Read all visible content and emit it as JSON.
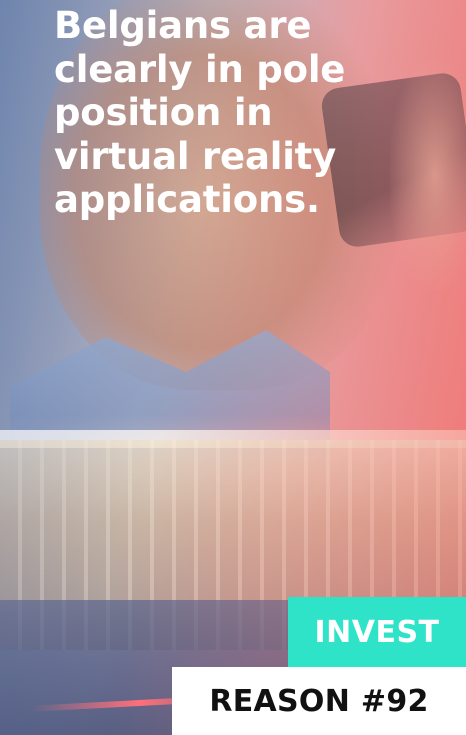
{
  "headline": {
    "lines": [
      "Belgians are",
      "clearly in pole",
      "position in",
      "virtual reality",
      "applications."
    ]
  },
  "badges": {
    "invest": "INVEST",
    "reason": "REASON #92"
  },
  "colors": {
    "invest_badge_bg": "#2ee3c7",
    "reason_badge_bg": "#ffffff",
    "headline_text": "#ffffff"
  }
}
